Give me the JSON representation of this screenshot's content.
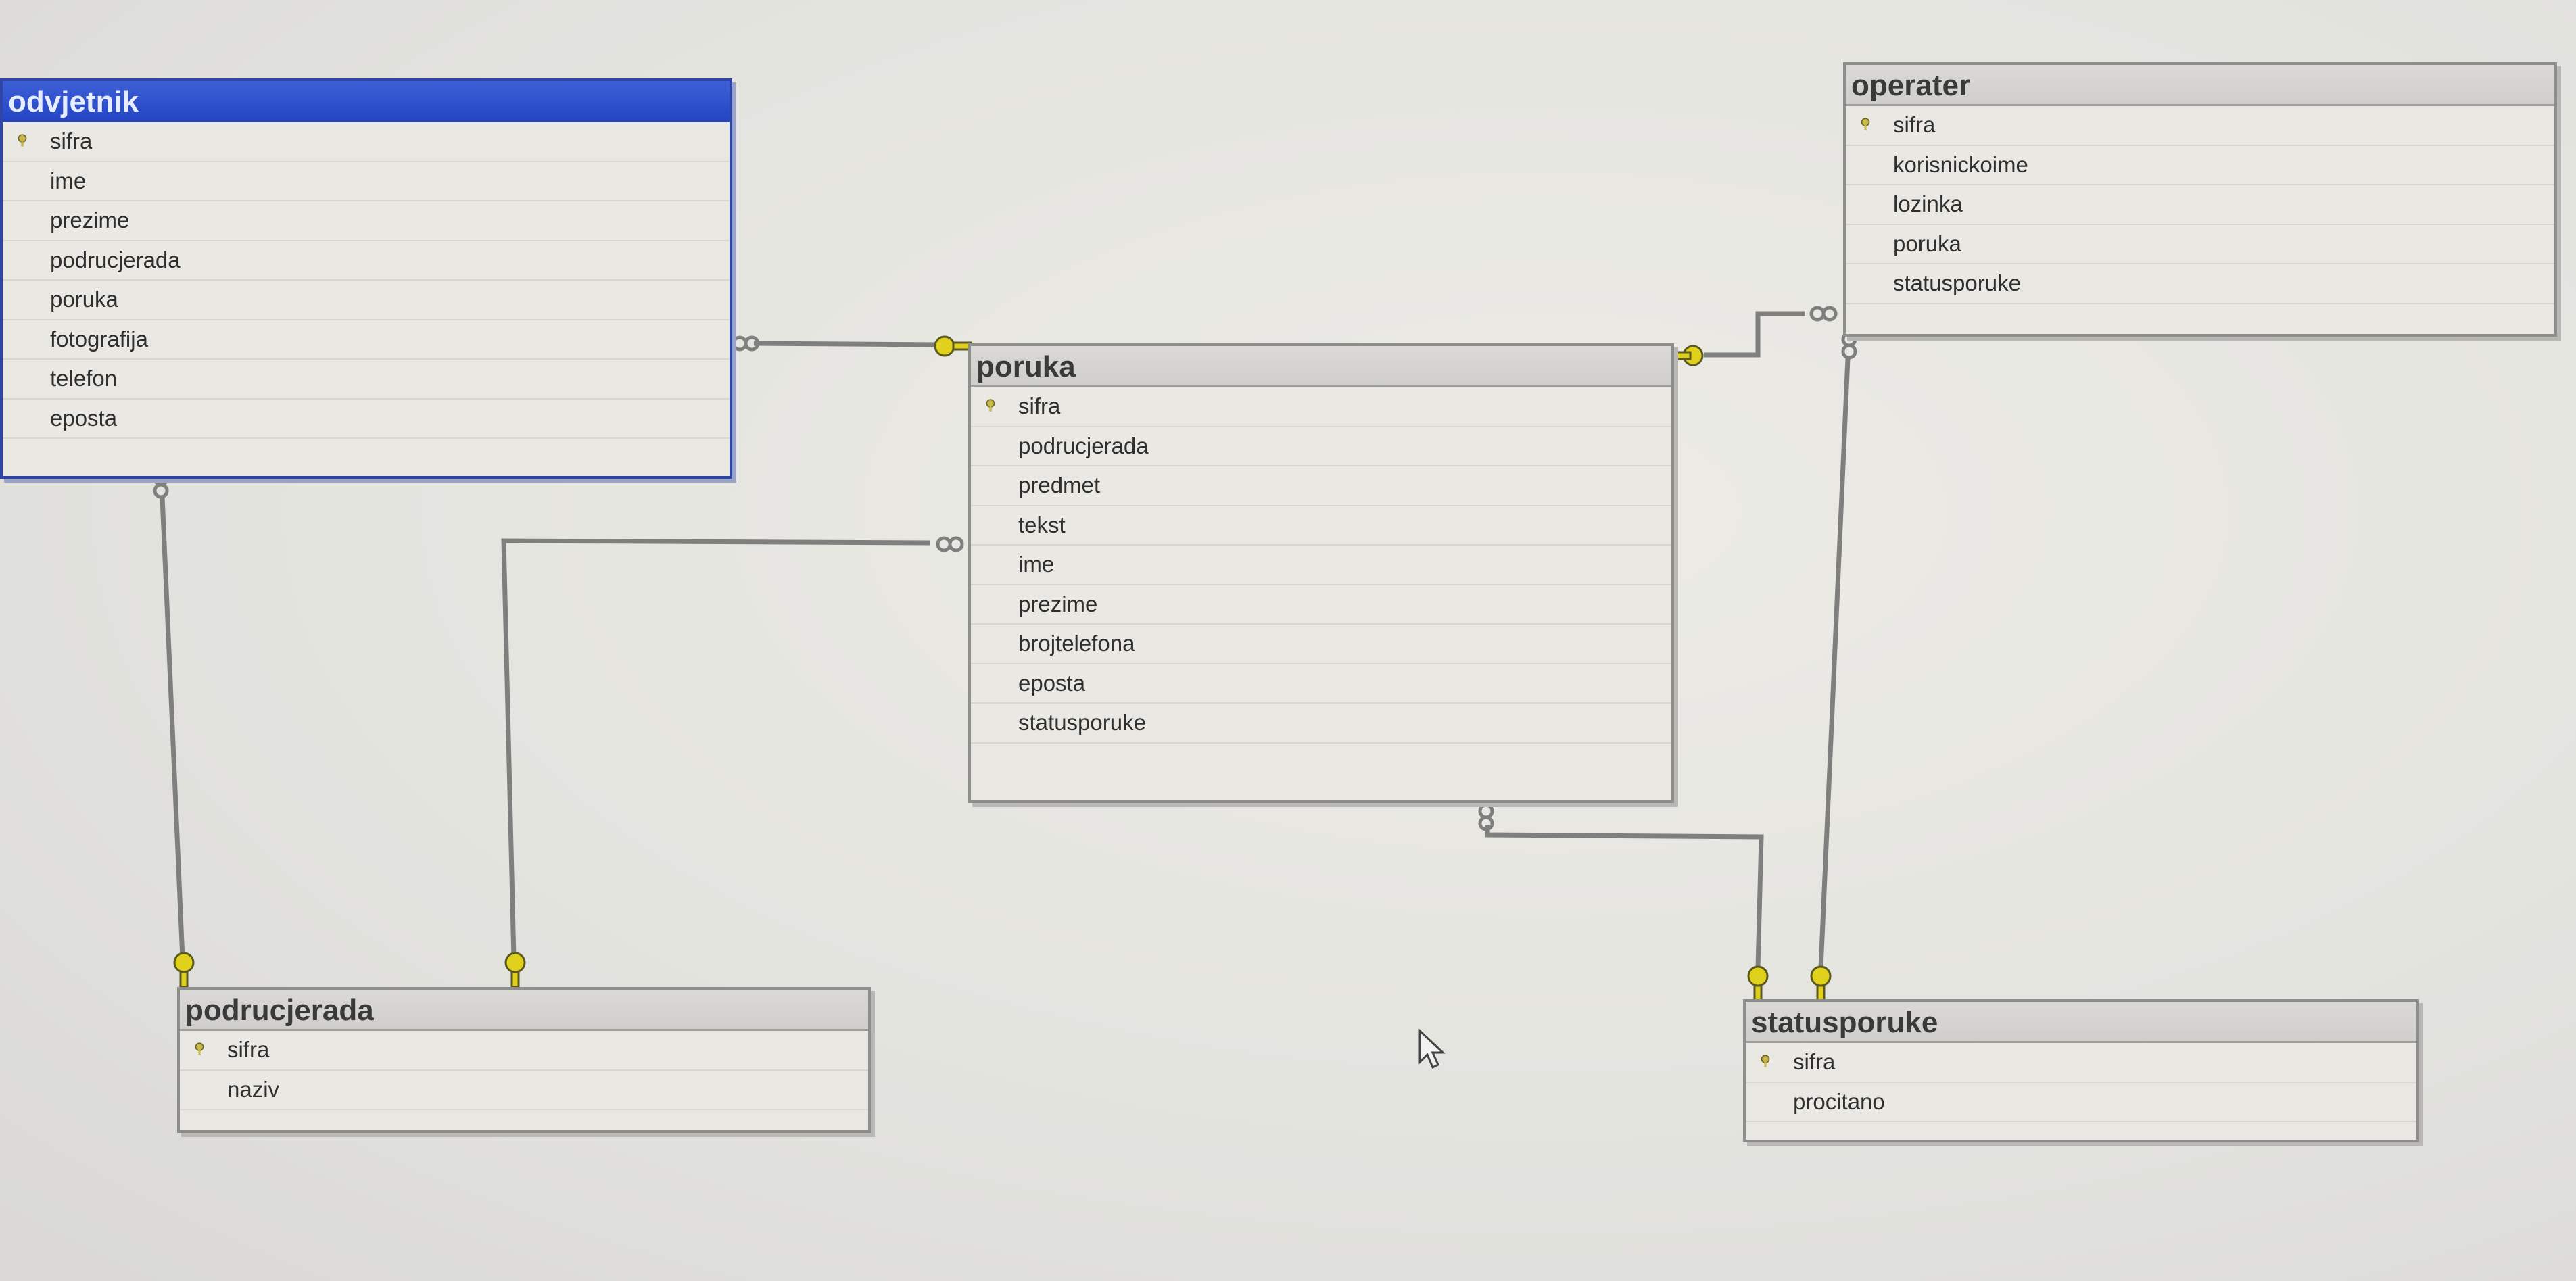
{
  "tables": {
    "odvjetnik": {
      "name": "odvjetnik",
      "columns": [
        "sifra",
        "ime",
        "prezime",
        "podrucjerada",
        "poruka",
        "fotografija",
        "telefon",
        "eposta"
      ]
    },
    "operater": {
      "name": "operater",
      "columns": [
        "sifra",
        "korisnickoime",
        "lozinka",
        "poruka",
        "statusporuke"
      ]
    },
    "poruka": {
      "name": "poruka",
      "columns": [
        "sifra",
        "podrucjerada",
        "predmet",
        "tekst",
        "ime",
        "prezime",
        "brojtelefona",
        "eposta",
        "statusporuke"
      ]
    },
    "podrucjerada": {
      "name": "podrucjerada",
      "columns": [
        "sifra",
        "naziv"
      ]
    },
    "statusporuke": {
      "name": "statusporuke",
      "columns": [
        "sifra",
        "procitano"
      ]
    }
  },
  "icons": {
    "primary_key": "key-icon",
    "relationship_one": "key-end-icon",
    "relationship_many": "infinity-end-icon",
    "cursor": "mouse-pointer-icon"
  },
  "colors": {
    "selected_header": "#2446c4",
    "key_yellow": "#e0d21c",
    "line": "#7f7f7d"
  }
}
